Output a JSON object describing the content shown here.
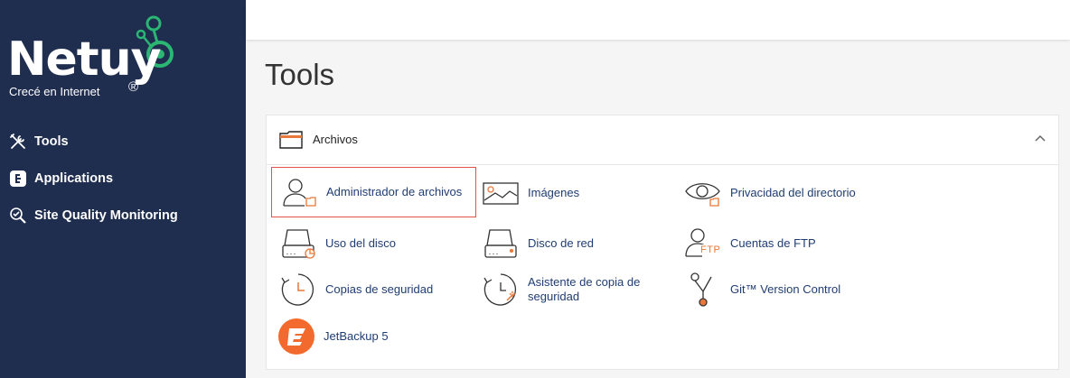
{
  "brand": {
    "name": "Netuy",
    "tagline": "Crecé en Internet",
    "reg": "®"
  },
  "colors": {
    "sidebar": "#1f2d4f",
    "accent_green": "#2bb673",
    "link": "#1f3d73",
    "icon_orange": "#e8773a",
    "selected_border": "#e2544a"
  },
  "sidebar": {
    "items": [
      {
        "label": "Tools",
        "icon": "tools-icon"
      },
      {
        "label": "Applications",
        "icon": "applications-icon"
      },
      {
        "label": "Site Quality Monitoring",
        "icon": "magnifier-icon"
      }
    ]
  },
  "page": {
    "title": "Tools"
  },
  "panel": {
    "title": "Archivos",
    "tools": [
      {
        "label": "Administrador de archivos",
        "icon": "file-manager-icon",
        "selected": true
      },
      {
        "label": "Imágenes",
        "icon": "images-icon"
      },
      {
        "label": "Privacidad del directorio",
        "icon": "directory-privacy-icon"
      },
      {
        "label": "Uso del disco",
        "icon": "disk-usage-icon"
      },
      {
        "label": "Disco de red",
        "icon": "network-disk-icon"
      },
      {
        "label": "Cuentas de FTP",
        "icon": "ftp-accounts-icon",
        "badge": "FTP"
      },
      {
        "label": "Copias de seguridad",
        "icon": "backup-icon"
      },
      {
        "label": "Asistente de copia de seguridad",
        "icon": "backup-wizard-icon"
      },
      {
        "label": "Git™ Version Control",
        "icon": "git-icon"
      },
      {
        "label": "JetBackup 5",
        "icon": "jetbackup-icon"
      }
    ]
  }
}
